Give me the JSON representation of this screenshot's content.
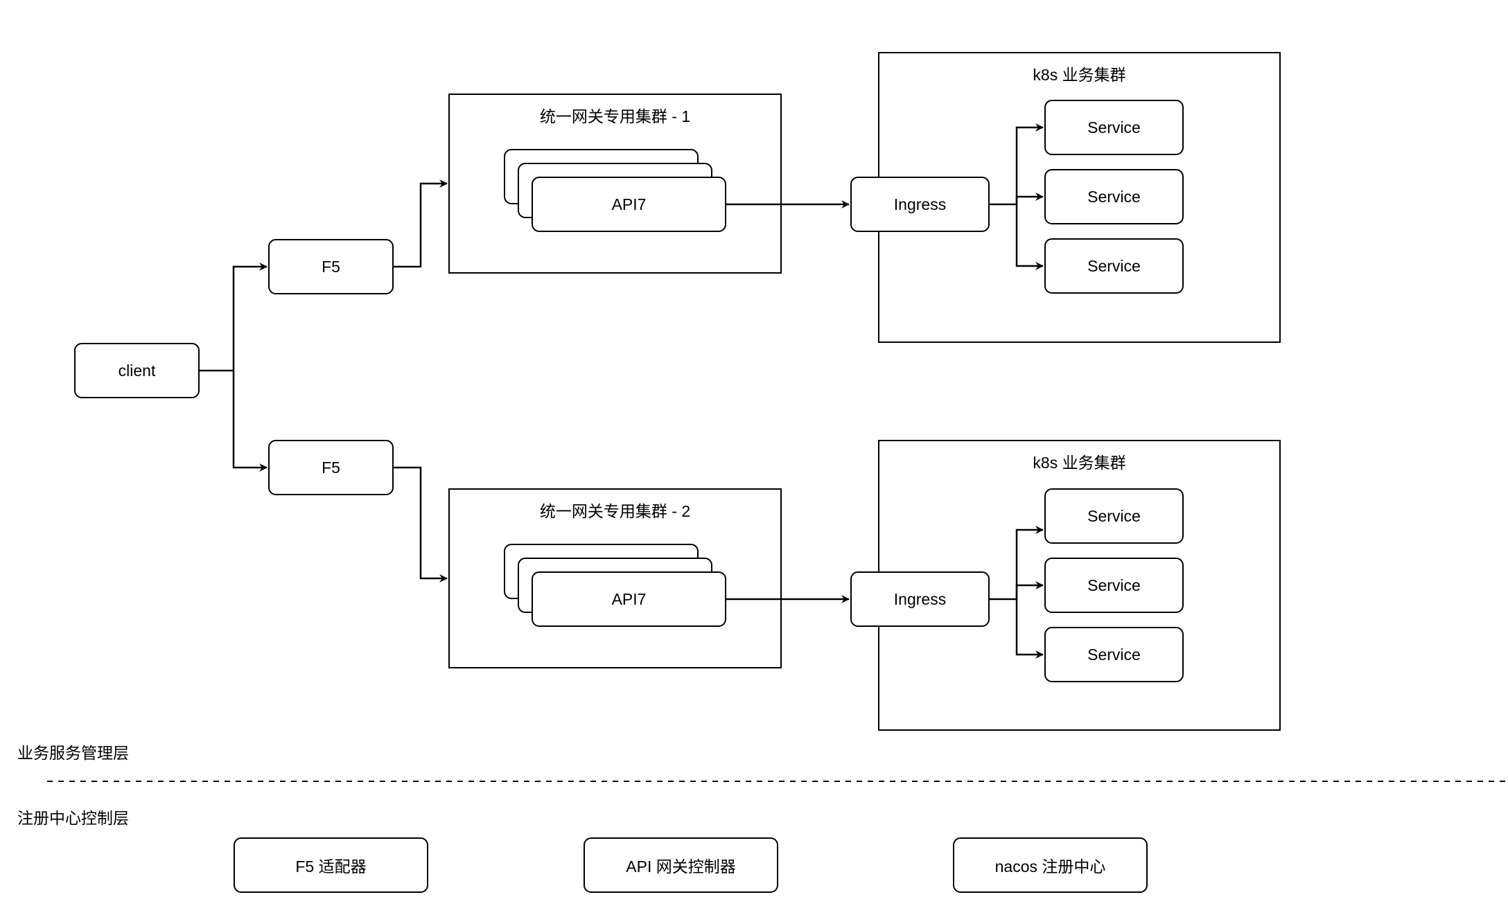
{
  "diagram": {
    "client": "client",
    "f5_nodes": [
      "F5",
      "F5"
    ],
    "gateway_clusters": [
      {
        "title": "统一网关专用集群 - 1",
        "instance": "API7"
      },
      {
        "title": "统一网关专用集群 - 2",
        "instance": "API7"
      }
    ],
    "k8s_clusters": [
      {
        "title": "k8s 业务集群",
        "ingress": "Ingress",
        "services": [
          "Service",
          "Service",
          "Service"
        ]
      },
      {
        "title": "k8s 业务集群",
        "ingress": "Ingress",
        "services": [
          "Service",
          "Service",
          "Service"
        ]
      }
    ],
    "layers": {
      "business": "业务服务管理层",
      "control": "注册中心控制层"
    },
    "control_components": [
      "F5 适配器",
      "API 网关控制器",
      "nacos 注册中心"
    ]
  }
}
